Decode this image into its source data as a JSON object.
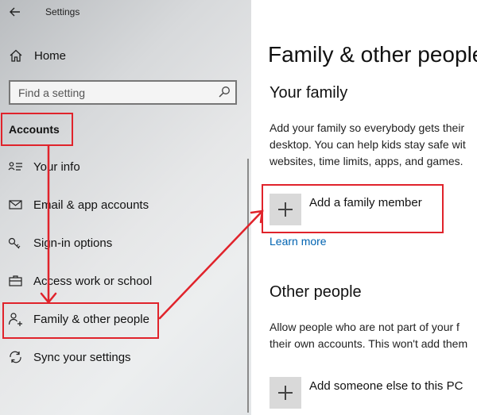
{
  "window": {
    "title": "Settings"
  },
  "sidebar": {
    "home_label": "Home",
    "search": {
      "placeholder": "Find a setting"
    },
    "section_heading": "Accounts",
    "items": [
      {
        "label": "Your info",
        "icon": "contact-card-icon"
      },
      {
        "label": "Email & app accounts",
        "icon": "mail-icon"
      },
      {
        "label": "Sign-in options",
        "icon": "key-icon"
      },
      {
        "label": "Access work or school",
        "icon": "briefcase-icon"
      },
      {
        "label": "Family & other people",
        "icon": "add-person-icon"
      },
      {
        "label": "Sync your settings",
        "icon": "sync-icon"
      }
    ]
  },
  "main": {
    "title": "Family & other people",
    "family": {
      "heading": "Your family",
      "description_lines": [
        "Add your family so everybody gets their",
        "desktop. You can help kids stay safe wit",
        "websites, time limits, apps, and games."
      ],
      "add_label": "Add a family member",
      "learn_more": "Learn more"
    },
    "other": {
      "heading": "Other people",
      "description_lines": [
        "Allow people who are not part of your f",
        "their own accounts. This won't add them"
      ],
      "add_label": "Add someone else to this PC"
    }
  },
  "colors": {
    "annotation": "#e0232b",
    "link": "#0063b1",
    "tile": "#d9d9d9"
  }
}
